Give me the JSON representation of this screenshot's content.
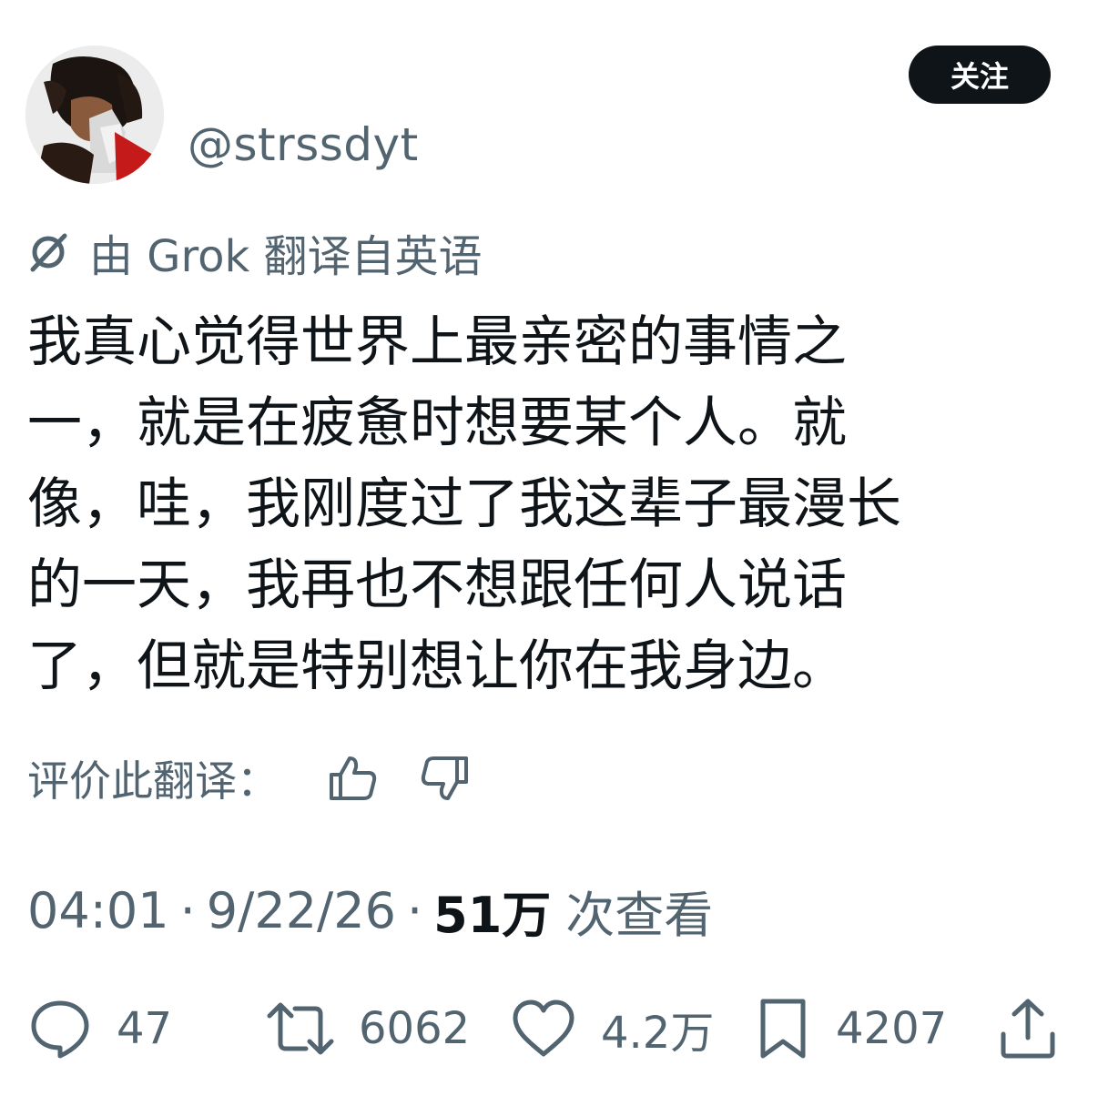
{
  "author": {
    "handle": "@strssdyt"
  },
  "follow_button": {
    "label": "关注"
  },
  "translation": {
    "notice": "由 Grok 翻译自英语",
    "rate_label": "评价此翻译："
  },
  "tweet": {
    "lines": [
      "我真心觉得世界上最亲密的事情之",
      "一，就是在疲惫时想要某个人。就",
      "像，哇，我刚度过了我这辈子最漫长",
      "的一天，我再也不想跟任何人说话",
      "了，但就是特别想让你在我身边。"
    ]
  },
  "meta": {
    "time": "04:01",
    "date": "9/22/26",
    "views_count": "51万",
    "views_label": "次查看"
  },
  "actions": {
    "replies": "47",
    "retweets": "6062",
    "likes": "4.2万",
    "bookmarks": "4207"
  },
  "icons": {
    "grok": "grok-icon",
    "thumbs_up": "thumbs-up-icon",
    "thumbs_down": "thumbs-down-icon",
    "reply": "reply-icon",
    "retweet": "retweet-icon",
    "like": "heart-icon",
    "bookmark": "bookmark-icon",
    "share": "share-icon"
  },
  "colors": {
    "text_primary": "#0f1419",
    "text_secondary": "#536471",
    "button_bg": "#0f1419",
    "button_text": "#ffffff"
  }
}
